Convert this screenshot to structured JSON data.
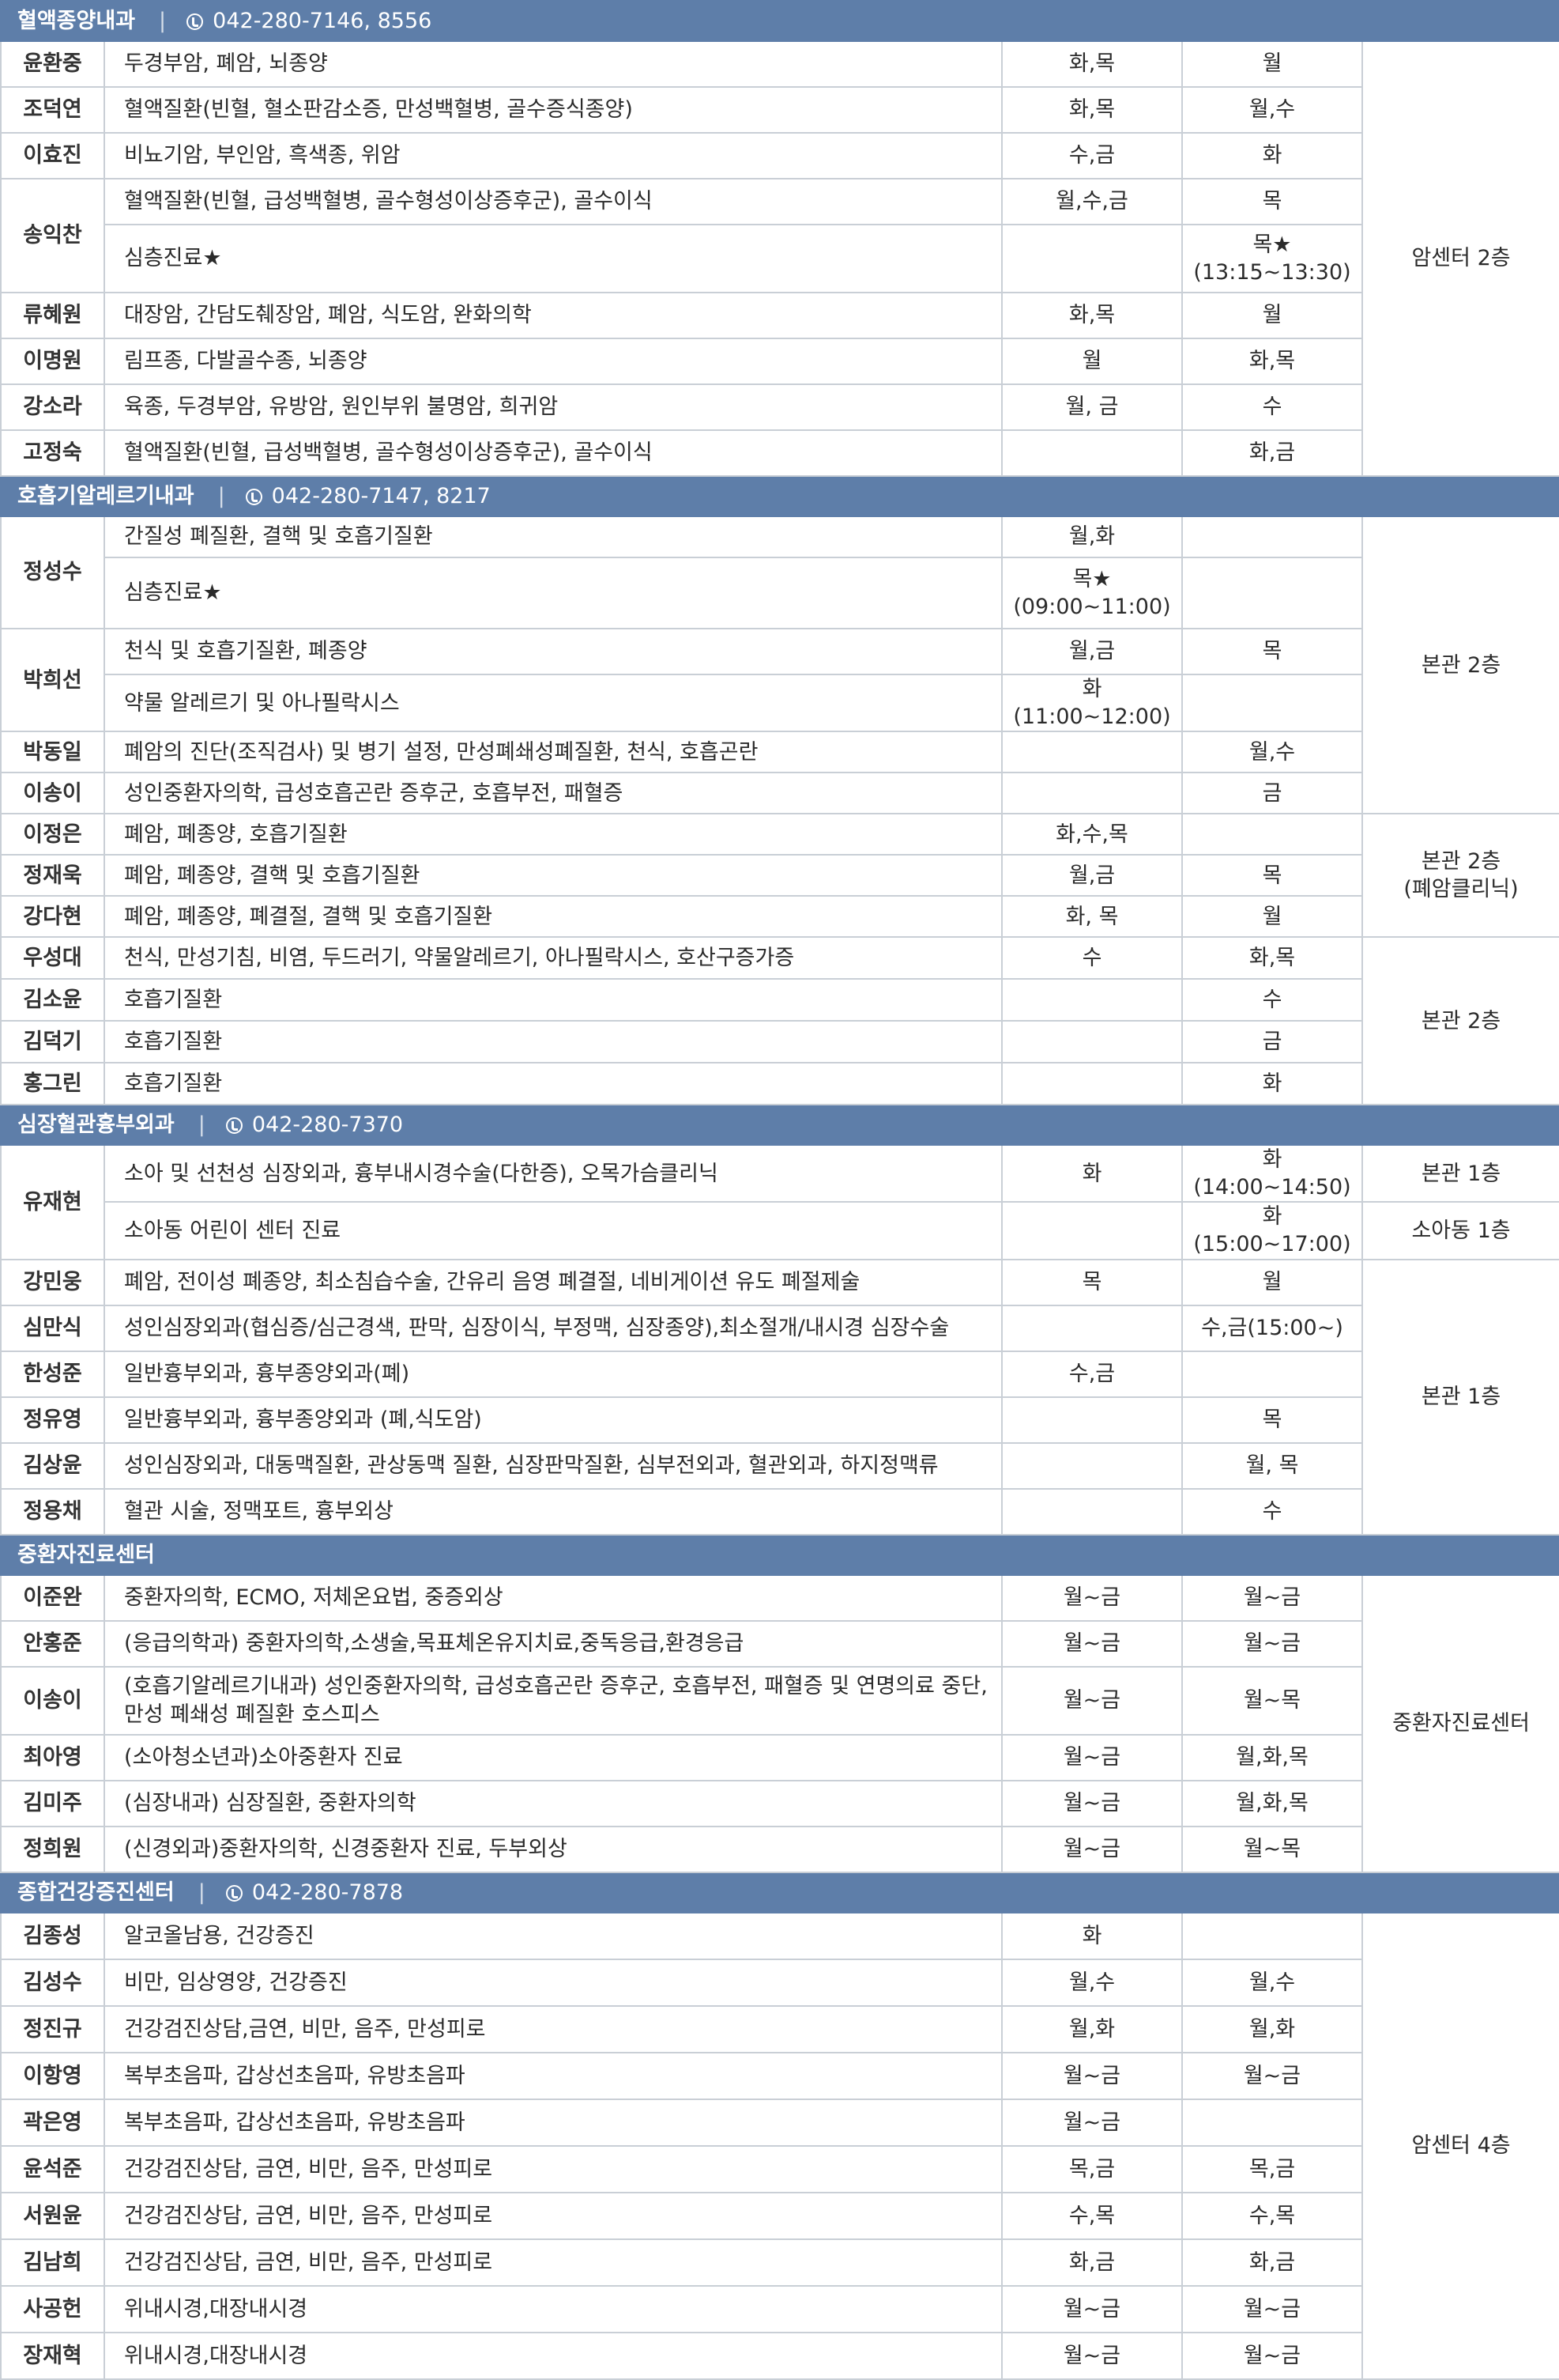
{
  "departments": [
    {
      "name": "혈액종양내과",
      "phone": "042-280-7146, 8556",
      "rows": [
        {
          "doctor": "윤환중",
          "specialty": "두경부암, 폐암, 뇌종양",
          "outpatient": "화,목",
          "ward": "월"
        },
        {
          "doctor": "조덕연",
          "specialty": "혈액질환(빈혈, 혈소판감소증, 만성백혈병, 골수증식종양)",
          "outpatient": "화,목",
          "ward": "월,수"
        },
        {
          "doctor": "이효진",
          "specialty": "비뇨기암, 부인암, 흑색종, 위암",
          "outpatient": "수,금",
          "ward": "화"
        },
        {
          "doctor": "송익찬",
          "specialty": "혈액질환(빈혈, 급성백혈병, 골수형성이상증후군), 골수이식",
          "outpatient": "월,수,금",
          "ward": "목"
        },
        {
          "doctor": "",
          "specialty": "심층진료★",
          "outpatient": "",
          "ward": "목★",
          "ward_note": "(13:15~13:30)"
        },
        {
          "doctor": "류혜원",
          "specialty": "대장암, 간담도췌장암, 폐암, 식도암, 완화의학",
          "outpatient": "화,목",
          "ward": "월"
        },
        {
          "doctor": "이명원",
          "specialty": "림프종, 다발골수종, 뇌종양",
          "outpatient": "월",
          "ward": "화,목"
        },
        {
          "doctor": "강소라",
          "specialty": "육종, 두경부암, 유방암, 원인부위 불명암, 희귀암",
          "outpatient": "월, 금",
          "ward": "수"
        },
        {
          "doctor": "고정숙",
          "specialty": "혈액질환(빈혈, 급성백혈병, 골수형성이상증후군), 골수이식",
          "outpatient": "",
          "ward": "화,금"
        }
      ],
      "locations": [
        "암센터 2층"
      ]
    },
    {
      "name": "호흡기알레르기내과",
      "phone": "042-280-7147, 8217",
      "rows": [
        {
          "doctor": "정성수",
          "specialty": "간질성 폐질환, 결핵 및 호흡기질환",
          "outpatient": "월,화",
          "ward": ""
        },
        {
          "doctor": "",
          "specialty": "심층진료★",
          "outpatient": "목★",
          "outpatient_note": "(09:00~11:00)",
          "ward": ""
        },
        {
          "doctor": "박희선",
          "specialty": "천식 및 호흡기질환, 폐종양",
          "outpatient": "월,금",
          "ward": "목"
        },
        {
          "doctor": "",
          "specialty": "약물 알레르기 및 아나필락시스",
          "outpatient": "화(11:00~12:00)",
          "ward": ""
        },
        {
          "doctor": "박동일",
          "specialty": "폐암의 진단(조직검사) 및 병기 설정, 만성폐쇄성폐질환, 천식, 호흡곤란",
          "outpatient": "",
          "ward": "월,수"
        },
        {
          "doctor": "이송이",
          "specialty": "성인중환자의학, 급성호흡곤란 증후군, 호흡부전, 패혈증",
          "outpatient": "",
          "ward": "금"
        },
        {
          "doctor": "이정은",
          "specialty": "폐암, 폐종양, 호흡기질환",
          "outpatient": "화,수,목",
          "ward": ""
        },
        {
          "doctor": "정재욱",
          "specialty": "폐암, 폐종양, 결핵 및 호흡기질환",
          "outpatient": "월,금",
          "ward": "목"
        },
        {
          "doctor": "강다현",
          "specialty": "폐암, 폐종양, 폐결절, 결핵 및 호흡기질환",
          "outpatient": "화, 목",
          "ward": "월"
        },
        {
          "doctor": "우성대",
          "specialty": "천식, 만성기침, 비염, 두드러기, 약물알레르기, 아나필락시스, 호산구증가증",
          "outpatient": "수",
          "ward": "화,목"
        },
        {
          "doctor": "김소윤",
          "specialty": "호흡기질환",
          "outpatient": "",
          "ward": "수"
        },
        {
          "doctor": "김덕기",
          "specialty": "호흡기질환",
          "outpatient": "",
          "ward": "금"
        },
        {
          "doctor": "홍그린",
          "specialty": "호흡기질환",
          "outpatient": "",
          "ward": "화"
        }
      ],
      "locations": [
        "본관 2층",
        "본관 2층",
        "(폐암클리닉)",
        "본관 2층"
      ]
    },
    {
      "name": "심장혈관흉부외과",
      "phone": "042-280-7370",
      "rows": [
        {
          "doctor": "유재현",
          "specialty": "소아 및 선천성 심장외과, 흉부내시경수술(다한증), 오목가슴클리닉",
          "outpatient": "화",
          "ward": "화(14:00~14:50)"
        },
        {
          "doctor": "",
          "specialty": "소아동 어린이 센터 진료",
          "outpatient": "",
          "ward": "화(15:00~17:00)"
        },
        {
          "doctor": "강민웅",
          "specialty": "폐암, 전이성 폐종양, 최소침습수술, 간유리 음영 폐결절, 네비게이션 유도 폐절제술",
          "outpatient": "목",
          "ward": "월"
        },
        {
          "doctor": "심만식",
          "specialty": "성인심장외과(협심증/심근경색, 판막, 심장이식, 부정맥, 심장종양),최소절개/내시경 심장수술",
          "outpatient": "",
          "ward": "수,금(15:00~)"
        },
        {
          "doctor": "한성준",
          "specialty": "일반흉부외과, 흉부종양외과(폐)",
          "outpatient": "수,금",
          "ward": ""
        },
        {
          "doctor": "정유영",
          "specialty": "일반흉부외과, 흉부종양외과 (폐,식도암)",
          "outpatient": "",
          "ward": "목"
        },
        {
          "doctor": "김상윤",
          "specialty": "성인심장외과, 대동맥질환, 관상동맥 질환, 심장판막질환, 심부전외과, 혈관외과, 하지정맥류",
          "outpatient": "",
          "ward": "월, 목"
        },
        {
          "doctor": "정용채",
          "specialty": "혈관 시술, 정맥포트, 흉부외상",
          "outpatient": "",
          "ward": "수"
        }
      ],
      "locations": [
        "본관 1층",
        "소아동 1층",
        "본관 1층"
      ]
    },
    {
      "name": "중환자진료센터",
      "phone": "",
      "rows": [
        {
          "doctor": "이준완",
          "specialty": "중환자의학, ECMO, 저체온요법, 중증외상",
          "outpatient": "월~금",
          "ward": "월~금"
        },
        {
          "doctor": "안홍준",
          "specialty": "(응급의학과) 중환자의학,소생술,목표체온유지치료,중독응급,환경응급",
          "outpatient": "월~금",
          "ward": "월~금"
        },
        {
          "doctor": "이송이",
          "specialty": "(호흡기알레르기내과) 성인중환자의학, 급성호흡곤란 증후군, 호흡부전, 패혈증 및 연명의료 중단,",
          "specialty_line2": "만성 폐쇄성 폐질환 호스피스",
          "outpatient": "월~금",
          "ward": "월~목"
        },
        {
          "doctor": "최아영",
          "specialty": "(소아청소년과)소아중환자 진료",
          "outpatient": "월~금",
          "ward": "월,화,목"
        },
        {
          "doctor": "김미주",
          "specialty": "(심장내과) 심장질환, 중환자의학",
          "outpatient": "월~금",
          "ward": "월,화,목"
        },
        {
          "doctor": "정희원",
          "specialty": "(신경외과)중환자의학, 신경중환자 진료, 두부외상",
          "outpatient": "월~금",
          "ward": "월~목"
        }
      ],
      "locations": [
        "중환자진료센터"
      ]
    },
    {
      "name": "종합건강증진센터",
      "phone": "042-280-7878",
      "rows": [
        {
          "doctor": "김종성",
          "specialty": "알코올남용, 건강증진",
          "outpatient": "화",
          "ward": ""
        },
        {
          "doctor": "김성수",
          "specialty": "비만, 임상영양, 건강증진",
          "outpatient": "월,수",
          "ward": "월,수"
        },
        {
          "doctor": "정진규",
          "specialty": "건강검진상담,금연, 비만, 음주, 만성피로",
          "outpatient": "월,화",
          "ward": "월,화"
        },
        {
          "doctor": "이항영",
          "specialty": "복부초음파, 갑상선초음파, 유방초음파",
          "outpatient": "월~금",
          "ward": "월~금"
        },
        {
          "doctor": "곽은영",
          "specialty": "복부초음파, 갑상선초음파, 유방초음파",
          "outpatient": "월~금",
          "ward": ""
        },
        {
          "doctor": "윤석준",
          "specialty": "건강검진상담, 금연, 비만, 음주, 만성피로",
          "outpatient": "목,금",
          "ward": "목,금"
        },
        {
          "doctor": "서원윤",
          "specialty": "건강검진상담, 금연, 비만, 음주, 만성피로",
          "outpatient": "수,목",
          "ward": "수,목"
        },
        {
          "doctor": "김남희",
          "specialty": "건강검진상담, 금연, 비만, 음주, 만성피로",
          "outpatient": "화,금",
          "ward": "화,금"
        },
        {
          "doctor": "사공헌",
          "specialty": "위내시경,대장내시경",
          "outpatient": "월~금",
          "ward": "월~금"
        },
        {
          "doctor": "장재혁",
          "specialty": "위내시경,대장내시경",
          "outpatient": "월~금",
          "ward": "월~금"
        }
      ],
      "locations": [
        "암센터 4층"
      ]
    }
  ]
}
